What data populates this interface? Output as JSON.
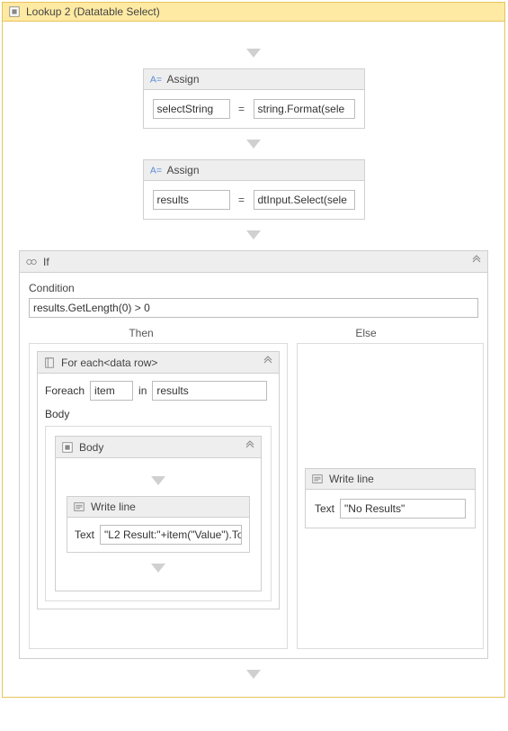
{
  "outer": {
    "title": "Lookup 2 (Datatable Select)"
  },
  "assign1": {
    "title": "Assign",
    "lhs": "selectString",
    "rhs": "string.Format(sele"
  },
  "assign2": {
    "title": "Assign",
    "lhs": "results",
    "rhs": "dtInput.Select(sele"
  },
  "if": {
    "title": "If",
    "conditionLabel": "Condition",
    "condition": "results.GetLength(0) > 0",
    "thenLabel": "Then",
    "elseLabel": "Else"
  },
  "foreach": {
    "title": "For each<data row>",
    "foreachLabel": "Foreach",
    "item": "item",
    "inLabel": "in",
    "collection": "results",
    "bodyLabel": "Body"
  },
  "bodySeq": {
    "title": "Body"
  },
  "writeThen": {
    "title": "Write line",
    "textLabel": "Text",
    "expr": "\"L2 Result:\"+item(\"Value\").To"
  },
  "writeElse": {
    "title": "Write line",
    "textLabel": "Text",
    "expr": "\"No Results\""
  },
  "eq": "="
}
